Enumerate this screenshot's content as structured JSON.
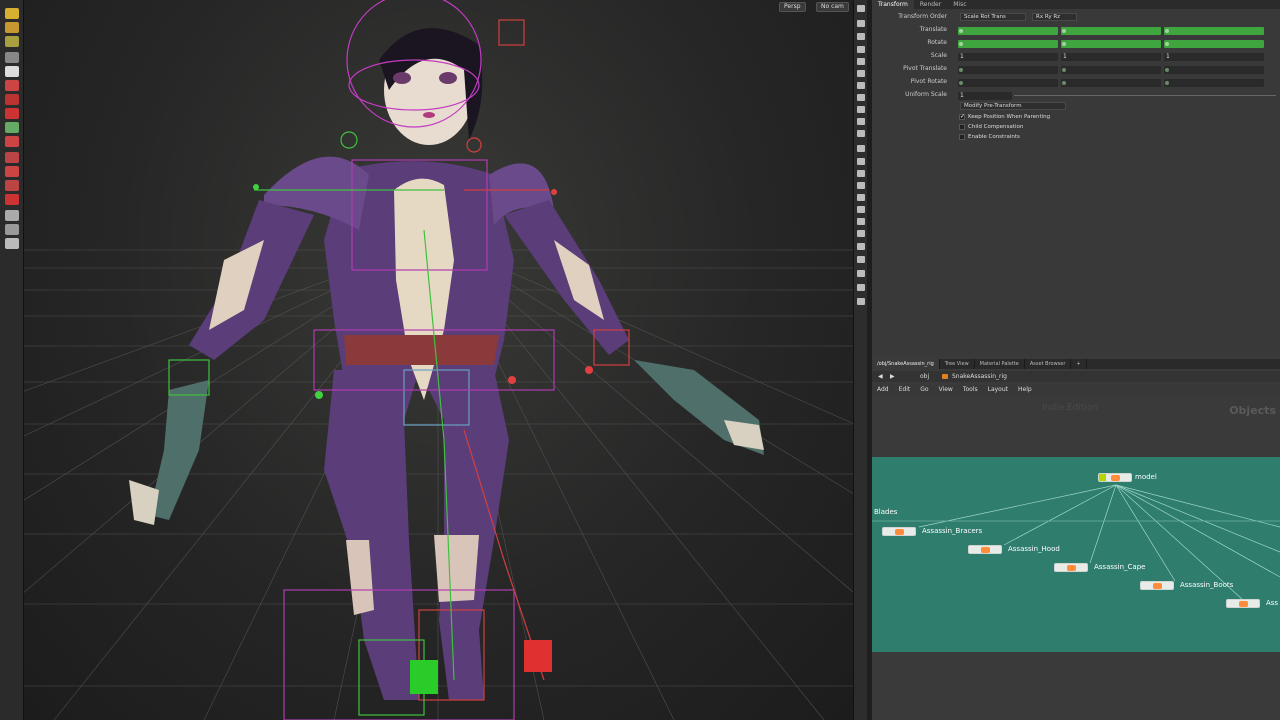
{
  "viewport": {
    "persp_label": "Persp",
    "cam_label": "No cam"
  },
  "params": {
    "tabs": [
      "Transform",
      "Render",
      "Misc"
    ],
    "transform_order_label": "Transform Order",
    "transform_order_value": "Scale Rot Trans",
    "rotate_order_value": "Rx Ry Rz",
    "rows": [
      {
        "label": "Translate",
        "values": [
          "0",
          "0",
          "0"
        ],
        "style": "green"
      },
      {
        "label": "Rotate",
        "values": [
          "0",
          "0",
          "0"
        ],
        "style": "green"
      },
      {
        "label": "Scale",
        "values": [
          "1",
          "1",
          "1"
        ],
        "style": "dark"
      },
      {
        "label": "Pivot Translate",
        "values": [
          "0",
          "0",
          "0"
        ],
        "style": "dark"
      },
      {
        "label": "Pivot Rotate",
        "values": [
          "0",
          "0",
          "0"
        ],
        "style": "dark"
      }
    ],
    "uniform_scale_label": "Uniform Scale",
    "uniform_scale_value": "1",
    "modify_pretransform": "Modify Pre-Transform",
    "checks": [
      {
        "label": "Keep Position When Parenting",
        "checked": true
      },
      {
        "label": "Child Compensation",
        "checked": false
      },
      {
        "label": "Enable Constraints",
        "checked": false
      }
    ]
  },
  "network": {
    "tabs": [
      "/obj/SnakeAssassin_rig",
      "Tree View",
      "Material Palette",
      "Asset Browser",
      "+"
    ],
    "path_root": "obj",
    "path_node": "SnakeAssassin_rig",
    "menu": [
      "Add",
      "Edit",
      "Go",
      "View",
      "Tools",
      "Layout",
      "Help"
    ],
    "watermark": "Indie Edition",
    "context_label": "Objects",
    "blades_label": "Blades",
    "nodes": [
      {
        "label": "model"
      },
      {
        "label": "Assassin_Bracers"
      },
      {
        "label": "Assassin_Hood"
      },
      {
        "label": "Assassin_Cape"
      },
      {
        "label": "Assassin_Boots"
      },
      {
        "label": "Ass"
      }
    ]
  }
}
